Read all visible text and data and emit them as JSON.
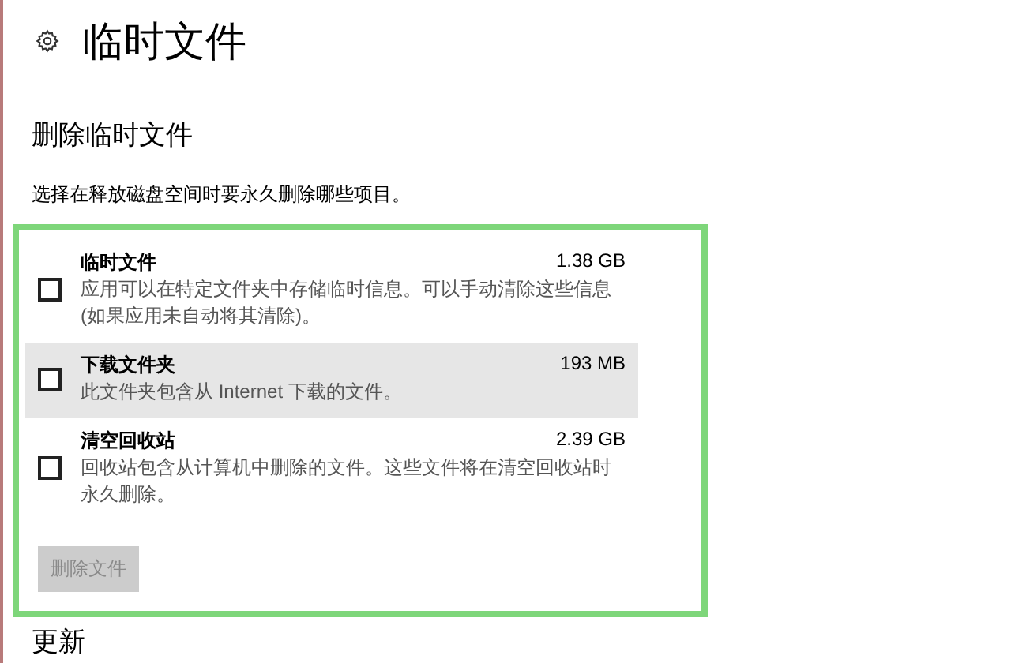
{
  "page": {
    "title": "临时文件"
  },
  "section": {
    "heading": "删除临时文件",
    "description": "选择在释放磁盘空间时要永久删除哪些项目。"
  },
  "items": [
    {
      "name": "临时文件",
      "size": "1.38 GB",
      "description": "应用可以在特定文件夹中存储临时信息。可以手动清除这些信息(如果应用未自动将其清除)。",
      "checked": false,
      "hovered": false
    },
    {
      "name": "下载文件夹",
      "size": "193 MB",
      "description": "此文件夹包含从 Internet 下载的文件。",
      "checked": false,
      "hovered": true
    },
    {
      "name": "清空回收站",
      "size": "2.39 GB",
      "description": "回收站包含从计算机中删除的文件。这些文件将在清空回收站时永久删除。",
      "checked": false,
      "hovered": false
    }
  ],
  "delete_button": {
    "label": "删除文件",
    "disabled": true
  },
  "next_section": {
    "heading": "更新"
  }
}
